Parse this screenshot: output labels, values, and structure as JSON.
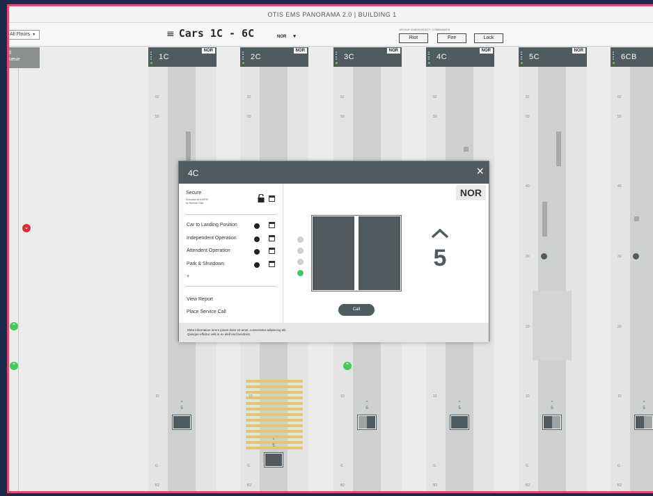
{
  "window": {
    "title": "OTIS EMS PANORAMA 2.0 | BUILDING 1"
  },
  "toolbar": {
    "floors_select": "All Floors",
    "cars_title": "Cars 1C - 6C",
    "mode_select": "NOR",
    "group_label": "GROUP EMERGENCY COMMANDS",
    "riot": "Riot",
    "fire": "Fire",
    "lock": "Lock"
  },
  "hall": {
    "line1": "ll",
    "line2": "ueue"
  },
  "cars": [
    {
      "name": "1C",
      "status": "NOR",
      "floor": "5"
    },
    {
      "name": "2C",
      "status": "NOR",
      "floor": "5"
    },
    {
      "name": "3C",
      "status": "NOR",
      "floor": "5"
    },
    {
      "name": "4C",
      "status": "NOR",
      "floor": "5"
    },
    {
      "name": "5C",
      "status": "NOR",
      "floor": "5"
    },
    {
      "name": "6CB",
      "status": "",
      "floor": "5"
    }
  ],
  "floor_labels": {
    "f52": "52",
    "f50": "50",
    "f40": "40",
    "f30": "30",
    "f20": "20",
    "f10": "10",
    "fg": "G",
    "fb2": "B2"
  },
  "modal": {
    "title": "4C",
    "status": "NOR",
    "secure": "Secure",
    "secure_sub1": "Unlocked at 4:00PM",
    "secure_sub2": "by Norman Gale",
    "options": [
      "Car to Landing Position",
      "Independent Operation",
      "Attendent Operation",
      "Park & Shutdown"
    ],
    "add": "+",
    "view_report": "View Report",
    "place_service_call": "Place Service Call",
    "floor": "5",
    "call_button": "Call",
    "footer1": "Meta information lorem ipsum dolor sit amet, consectetur adipiscing elit.",
    "footer2": "Quisque efficitur velit in ex eleif end hendrerit."
  },
  "colors": {
    "header": "#4f5b5e",
    "accent_border": "#e6466e",
    "up_indicator": "#46c95a",
    "down_indicator": "#d53333",
    "hatch": "#e3c76f"
  },
  "icons": {
    "menu": "hamburger-icon",
    "close": "close-icon",
    "lock": "unlock-icon",
    "up": "chevron-up-icon",
    "down": "chevron-down-icon"
  }
}
